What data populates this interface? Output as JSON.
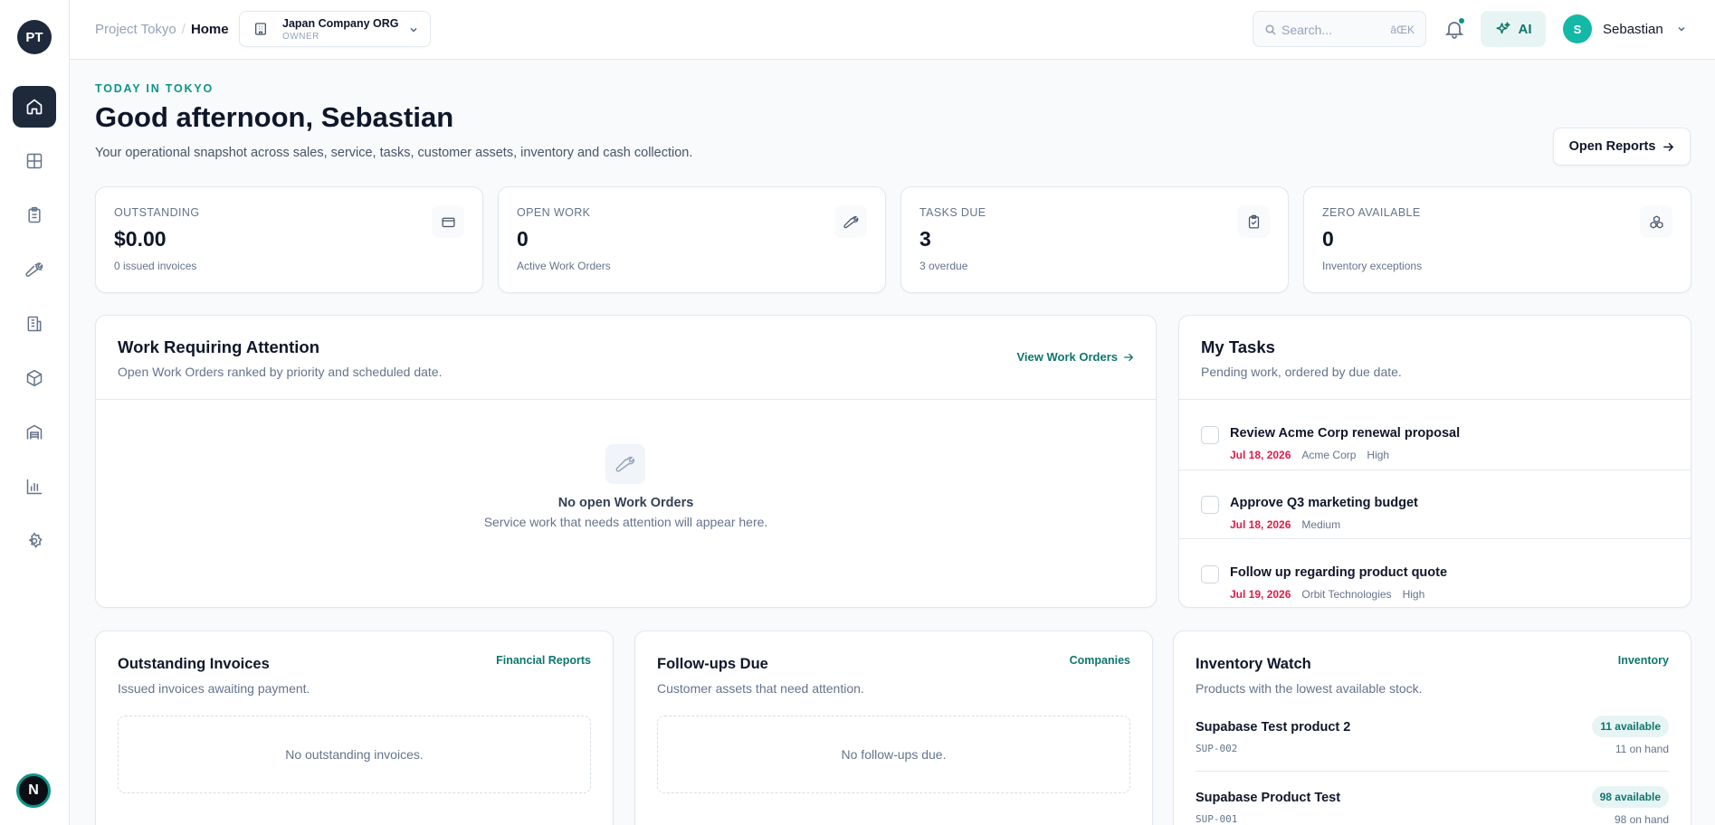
{
  "sidebar": {
    "logo": "PT",
    "items": [
      {
        "name": "home-icon",
        "active": true
      },
      {
        "name": "grid-icon"
      },
      {
        "name": "clipboard-icon"
      },
      {
        "name": "wrench-icon"
      },
      {
        "name": "building-icon"
      },
      {
        "name": "box-icon"
      },
      {
        "name": "warehouse-icon"
      },
      {
        "name": "chart-icon"
      },
      {
        "name": "gear-icon"
      }
    ],
    "bottom_badge": "N"
  },
  "topbar": {
    "breadcrumb": {
      "project": "Project Tokyo",
      "separator": "/",
      "current": "Home"
    },
    "org": {
      "name": "Japan Company ORG",
      "role": "OWNER"
    },
    "search": {
      "placeholder": "Search...",
      "shortcut": "âŒK"
    },
    "ai_label": "AI",
    "user": {
      "initial": "S",
      "name": "Sebastian"
    }
  },
  "header": {
    "eyebrow": "TODAY IN TOKYO",
    "title": "Good afternoon, Sebastian",
    "subtitle": "Your operational snapshot across sales, service, tasks, customer assets, inventory and cash collection.",
    "open_reports": "Open Reports"
  },
  "stats": [
    {
      "label": "OUTSTANDING",
      "value": "$0.00",
      "sub": "0 issued invoices",
      "icon": "credit-card-icon"
    },
    {
      "label": "OPEN WORK",
      "value": "0",
      "sub": "Active Work Orders",
      "icon": "wrench-icon"
    },
    {
      "label": "TASKS DUE",
      "value": "3",
      "sub": "3 overdue",
      "icon": "clipboard-check-icon"
    },
    {
      "label": "ZERO AVAILABLE",
      "value": "0",
      "sub": "Inventory exceptions",
      "icon": "boxes-icon"
    }
  ],
  "work": {
    "title": "Work Requiring Attention",
    "subtitle": "Open Work Orders ranked by priority and scheduled date.",
    "link": "View Work Orders",
    "empty_title": "No open Work Orders",
    "empty_sub": "Service work that needs attention will appear here."
  },
  "tasks": {
    "title": "My Tasks",
    "subtitle": "Pending work, ordered by due date.",
    "items": [
      {
        "name": "Review Acme Corp renewal proposal",
        "due": "Jul 18, 2026",
        "company": "Acme Corp",
        "priority": "High"
      },
      {
        "name": "Approve Q3 marketing budget",
        "due": "Jul 18, 2026",
        "priority": "Medium"
      },
      {
        "name": "Follow up regarding product quote",
        "due": "Jul 19, 2026",
        "company": "Orbit Technologies",
        "priority": "High"
      }
    ]
  },
  "invoices": {
    "title": "Outstanding Invoices",
    "subtitle": "Issued invoices awaiting payment.",
    "link": "Financial Reports",
    "empty": "No outstanding invoices."
  },
  "followups": {
    "title": "Follow-ups Due",
    "subtitle": "Customer assets that need attention.",
    "link": "Companies",
    "empty": "No follow-ups due."
  },
  "inventory": {
    "title": "Inventory Watch",
    "subtitle": "Products with the lowest available stock.",
    "link": "Inventory",
    "items": [
      {
        "name": "Supabase Test product 2",
        "sku": "SUP-002",
        "available": "11 available",
        "on_hand": "11 on hand"
      },
      {
        "name": "Supabase Product Test",
        "sku": "SUP-001",
        "available": "98 available",
        "on_hand": "98 on hand"
      }
    ]
  },
  "colors": {
    "accent": "#0d9488",
    "dark": "#1e293b",
    "danger": "#e11d48",
    "muted": "#64748b"
  }
}
